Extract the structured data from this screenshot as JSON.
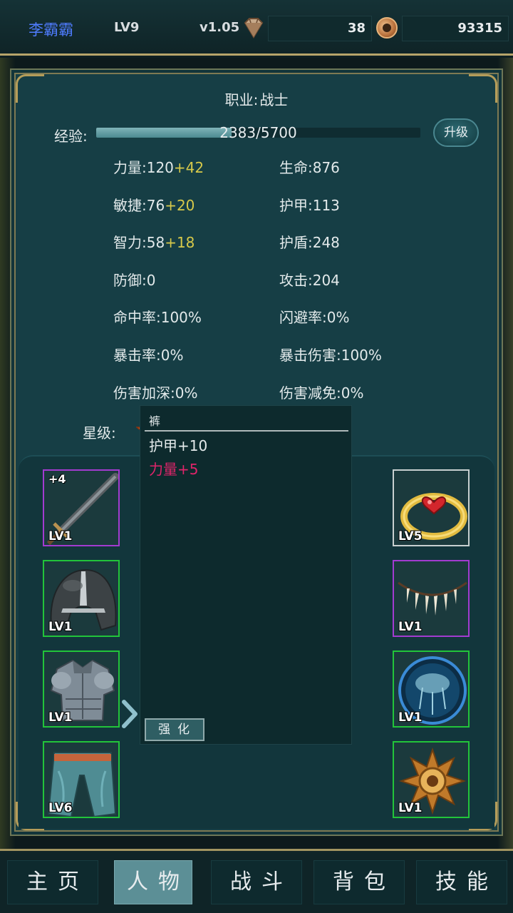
{
  "header": {
    "player_name": "李霸霸",
    "level": "LV9",
    "version": "v1.05",
    "gems": "38",
    "gold": "93315",
    "gem_icon": "diamond-icon",
    "coin_icon": "coin-icon"
  },
  "character": {
    "job_label": "职业:",
    "job_value": "战士",
    "exp_label": "经验:",
    "exp_text": "2383/5700",
    "exp_fraction": 0.418,
    "upgrade_label": "升级",
    "star_label": "星级:",
    "stars": 1
  },
  "stats_left": [
    {
      "label": "力量:120",
      "bonus": "+42"
    },
    {
      "label": "敏捷:76",
      "bonus": "+20"
    },
    {
      "label": "智力:58",
      "bonus": "+18"
    },
    {
      "label": "防御:0",
      "bonus": ""
    },
    {
      "label": "命中率:100%",
      "bonus": ""
    },
    {
      "label": "暴击率:0%",
      "bonus": ""
    },
    {
      "label": "伤害加深:0%",
      "bonus": ""
    }
  ],
  "stats_right": [
    {
      "label": "生命:876"
    },
    {
      "label": "护甲:113"
    },
    {
      "label": "护盾:248"
    },
    {
      "label": "攻击:204"
    },
    {
      "label": "闪避率:0%"
    },
    {
      "label": "暴击伤害:100%"
    },
    {
      "label": "伤害减免:0%"
    }
  ],
  "equipment_left": [
    {
      "name": "sword",
      "level": "LV1",
      "plus": "+4",
      "rarity": "purple"
    },
    {
      "name": "helmet",
      "level": "LV1",
      "plus": "",
      "rarity": "green"
    },
    {
      "name": "armor",
      "level": "LV1",
      "plus": "",
      "rarity": "green"
    },
    {
      "name": "pants",
      "level": "LV6",
      "plus": "",
      "rarity": "green"
    }
  ],
  "equipment_right": [
    {
      "name": "ring",
      "level": "LV5",
      "rarity": "white"
    },
    {
      "name": "necklace",
      "level": "LV1",
      "rarity": "purple"
    },
    {
      "name": "orb",
      "level": "LV1",
      "rarity": "green"
    },
    {
      "name": "amulet",
      "level": "LV1",
      "rarity": "green"
    }
  ],
  "detail": {
    "item_title": "裤",
    "line1": "护甲+10",
    "line2": "力量+5",
    "enhance_label": "强化"
  },
  "colors": {
    "bonus": "#d7c94a",
    "special_stat": "#e0246a",
    "name": "#4f7cff"
  },
  "nav": {
    "tabs": [
      "主页",
      "人物",
      "战斗",
      "背包",
      "技能"
    ],
    "active_index": 1
  }
}
